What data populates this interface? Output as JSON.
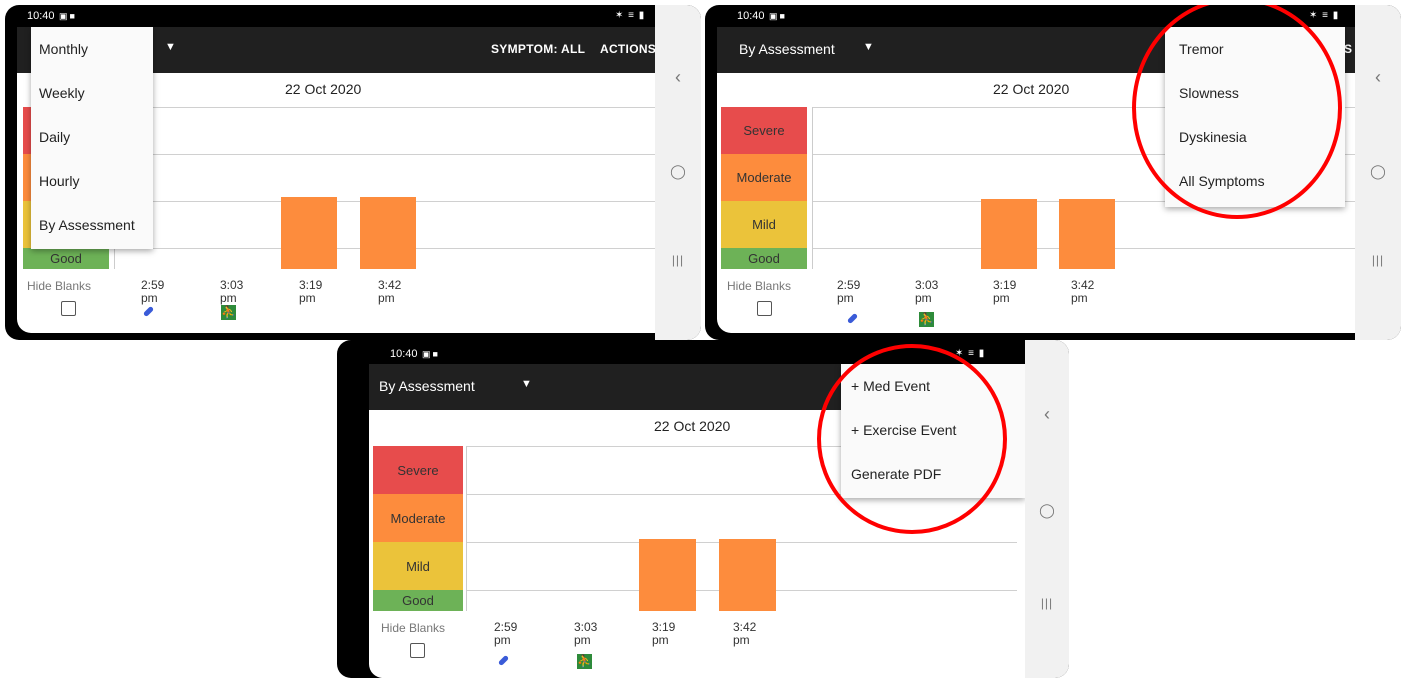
{
  "status_bar": {
    "time": "10:40",
    "system_icons": "✶ ≡ ▮"
  },
  "app_bar": {
    "view_selected": "By Assessment",
    "symptom_label": "SYMPTOM: ALL",
    "actions_label": "ACTIONS",
    "overflow_fragment": "S"
  },
  "date_header": "22 Oct 2020",
  "severity_legend": [
    "Severe",
    "Moderate",
    "Mild",
    "Good"
  ],
  "chart_data": {
    "type": "bar",
    "categories": [
      "2:59 pm",
      "3:03 pm",
      "3:19 pm",
      "3:42 pm"
    ],
    "series": [
      {
        "values": [
          null,
          null,
          "Moderate",
          "Moderate"
        ]
      }
    ],
    "y_levels": [
      "Good",
      "Mild",
      "Moderate",
      "Severe"
    ],
    "x_events": {
      "2:59 pm": "pill-icon",
      "3:03 pm": "running-person-icon"
    },
    "colors": {
      "Severe": "#e74c4c",
      "Moderate": "#fd8c3d",
      "Mild": "#ebc33a",
      "Good": "#6db257"
    }
  },
  "times": [
    {
      "time": "2:59",
      "ampm": "pm"
    },
    {
      "time": "3:03",
      "ampm": "pm"
    },
    {
      "time": "3:19",
      "ampm": "pm"
    },
    {
      "time": "3:42",
      "ampm": "pm"
    }
  ],
  "hide_blanks": {
    "label": "Hide Blanks",
    "checked": false
  },
  "view_menu": [
    "Monthly",
    "Weekly",
    "Daily",
    "Hourly",
    "By Assessment"
  ],
  "symptom_menu": [
    "Tremor",
    "Slowness",
    "Dyskinesia",
    "All Symptoms"
  ],
  "actions_menu": [
    "+ Med Event",
    "+ Exercise Event",
    "Generate PDF"
  ],
  "nav_icons": [
    "back-icon",
    "home-icon",
    "recents-icon"
  ],
  "annotation_color": "#ff0000"
}
